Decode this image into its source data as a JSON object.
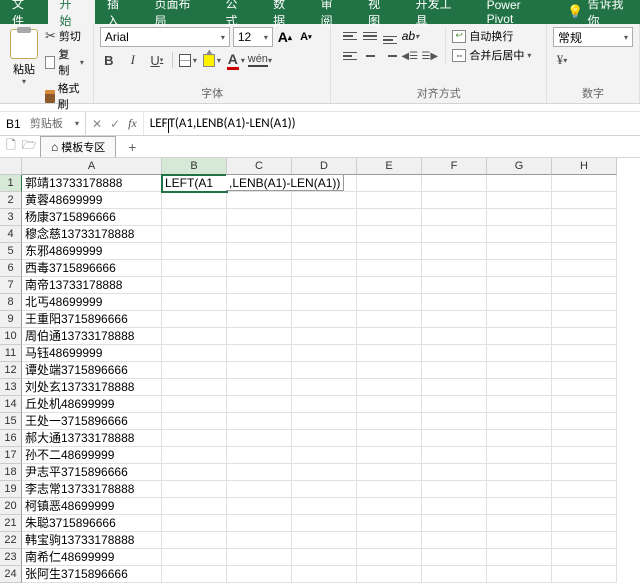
{
  "ribbon": {
    "tabs": [
      "文件",
      "开始",
      "插入",
      "页面布局",
      "公式",
      "数据",
      "审阅",
      "视图",
      "开发工具",
      "Power Pivot"
    ],
    "active_tab": "开始",
    "tell_me": "告诉我你"
  },
  "clipboard": {
    "paste": "粘贴",
    "cut": "剪切",
    "copy": "复制",
    "format_painter": "格式刷",
    "group_label": "剪贴板"
  },
  "font": {
    "name": "Arial",
    "size": "12",
    "group_label": "字体"
  },
  "alignment": {
    "wrap": "自动换行",
    "merge": "合并后居中",
    "group_label": "对齐方式"
  },
  "number": {
    "format": "常规",
    "group_label": "数字"
  },
  "name_box": "B1",
  "formula": {
    "prefix": "LEF",
    "suffix": "T(A1,LENB(A1)-LEN(A1))"
  },
  "sheet_tabs": {
    "template_zone": "模板专区"
  },
  "columns": [
    "A",
    "B",
    "C",
    "D",
    "E",
    "F",
    "G",
    "H"
  ],
  "active_col": "B",
  "edit_cell": {
    "part1": "LEFT(A1",
    "part2": ",LENB(A1)-LEN(A1))"
  },
  "rows": [
    {
      "n": "1",
      "a": "郭靖13733178888"
    },
    {
      "n": "2",
      "a": "黄蓉48699999"
    },
    {
      "n": "3",
      "a": "杨康3715896666"
    },
    {
      "n": "4",
      "a": "穆念慈13733178888"
    },
    {
      "n": "5",
      "a": "东邪48699999"
    },
    {
      "n": "6",
      "a": "西毒3715896666"
    },
    {
      "n": "7",
      "a": "南帝13733178888"
    },
    {
      "n": "8",
      "a": "北丐48699999"
    },
    {
      "n": "9",
      "a": "王重阳3715896666"
    },
    {
      "n": "10",
      "a": "周伯通13733178888"
    },
    {
      "n": "11",
      "a": "马钰48699999"
    },
    {
      "n": "12",
      "a": "谭处端3715896666"
    },
    {
      "n": "13",
      "a": "刘处玄13733178888"
    },
    {
      "n": "14",
      "a": "丘处机48699999"
    },
    {
      "n": "15",
      "a": "王处一3715896666"
    },
    {
      "n": "16",
      "a": "郝大通13733178888"
    },
    {
      "n": "17",
      "a": "孙不二48699999"
    },
    {
      "n": "18",
      "a": "尹志平3715896666"
    },
    {
      "n": "19",
      "a": "李志常13733178888"
    },
    {
      "n": "20",
      "a": "柯镇恶48699999"
    },
    {
      "n": "21",
      "a": "朱聪3715896666"
    },
    {
      "n": "22",
      "a": "韩宝驹13733178888"
    },
    {
      "n": "23",
      "a": "南希仁48699999"
    },
    {
      "n": "24",
      "a": "张阿生3715896666"
    }
  ]
}
